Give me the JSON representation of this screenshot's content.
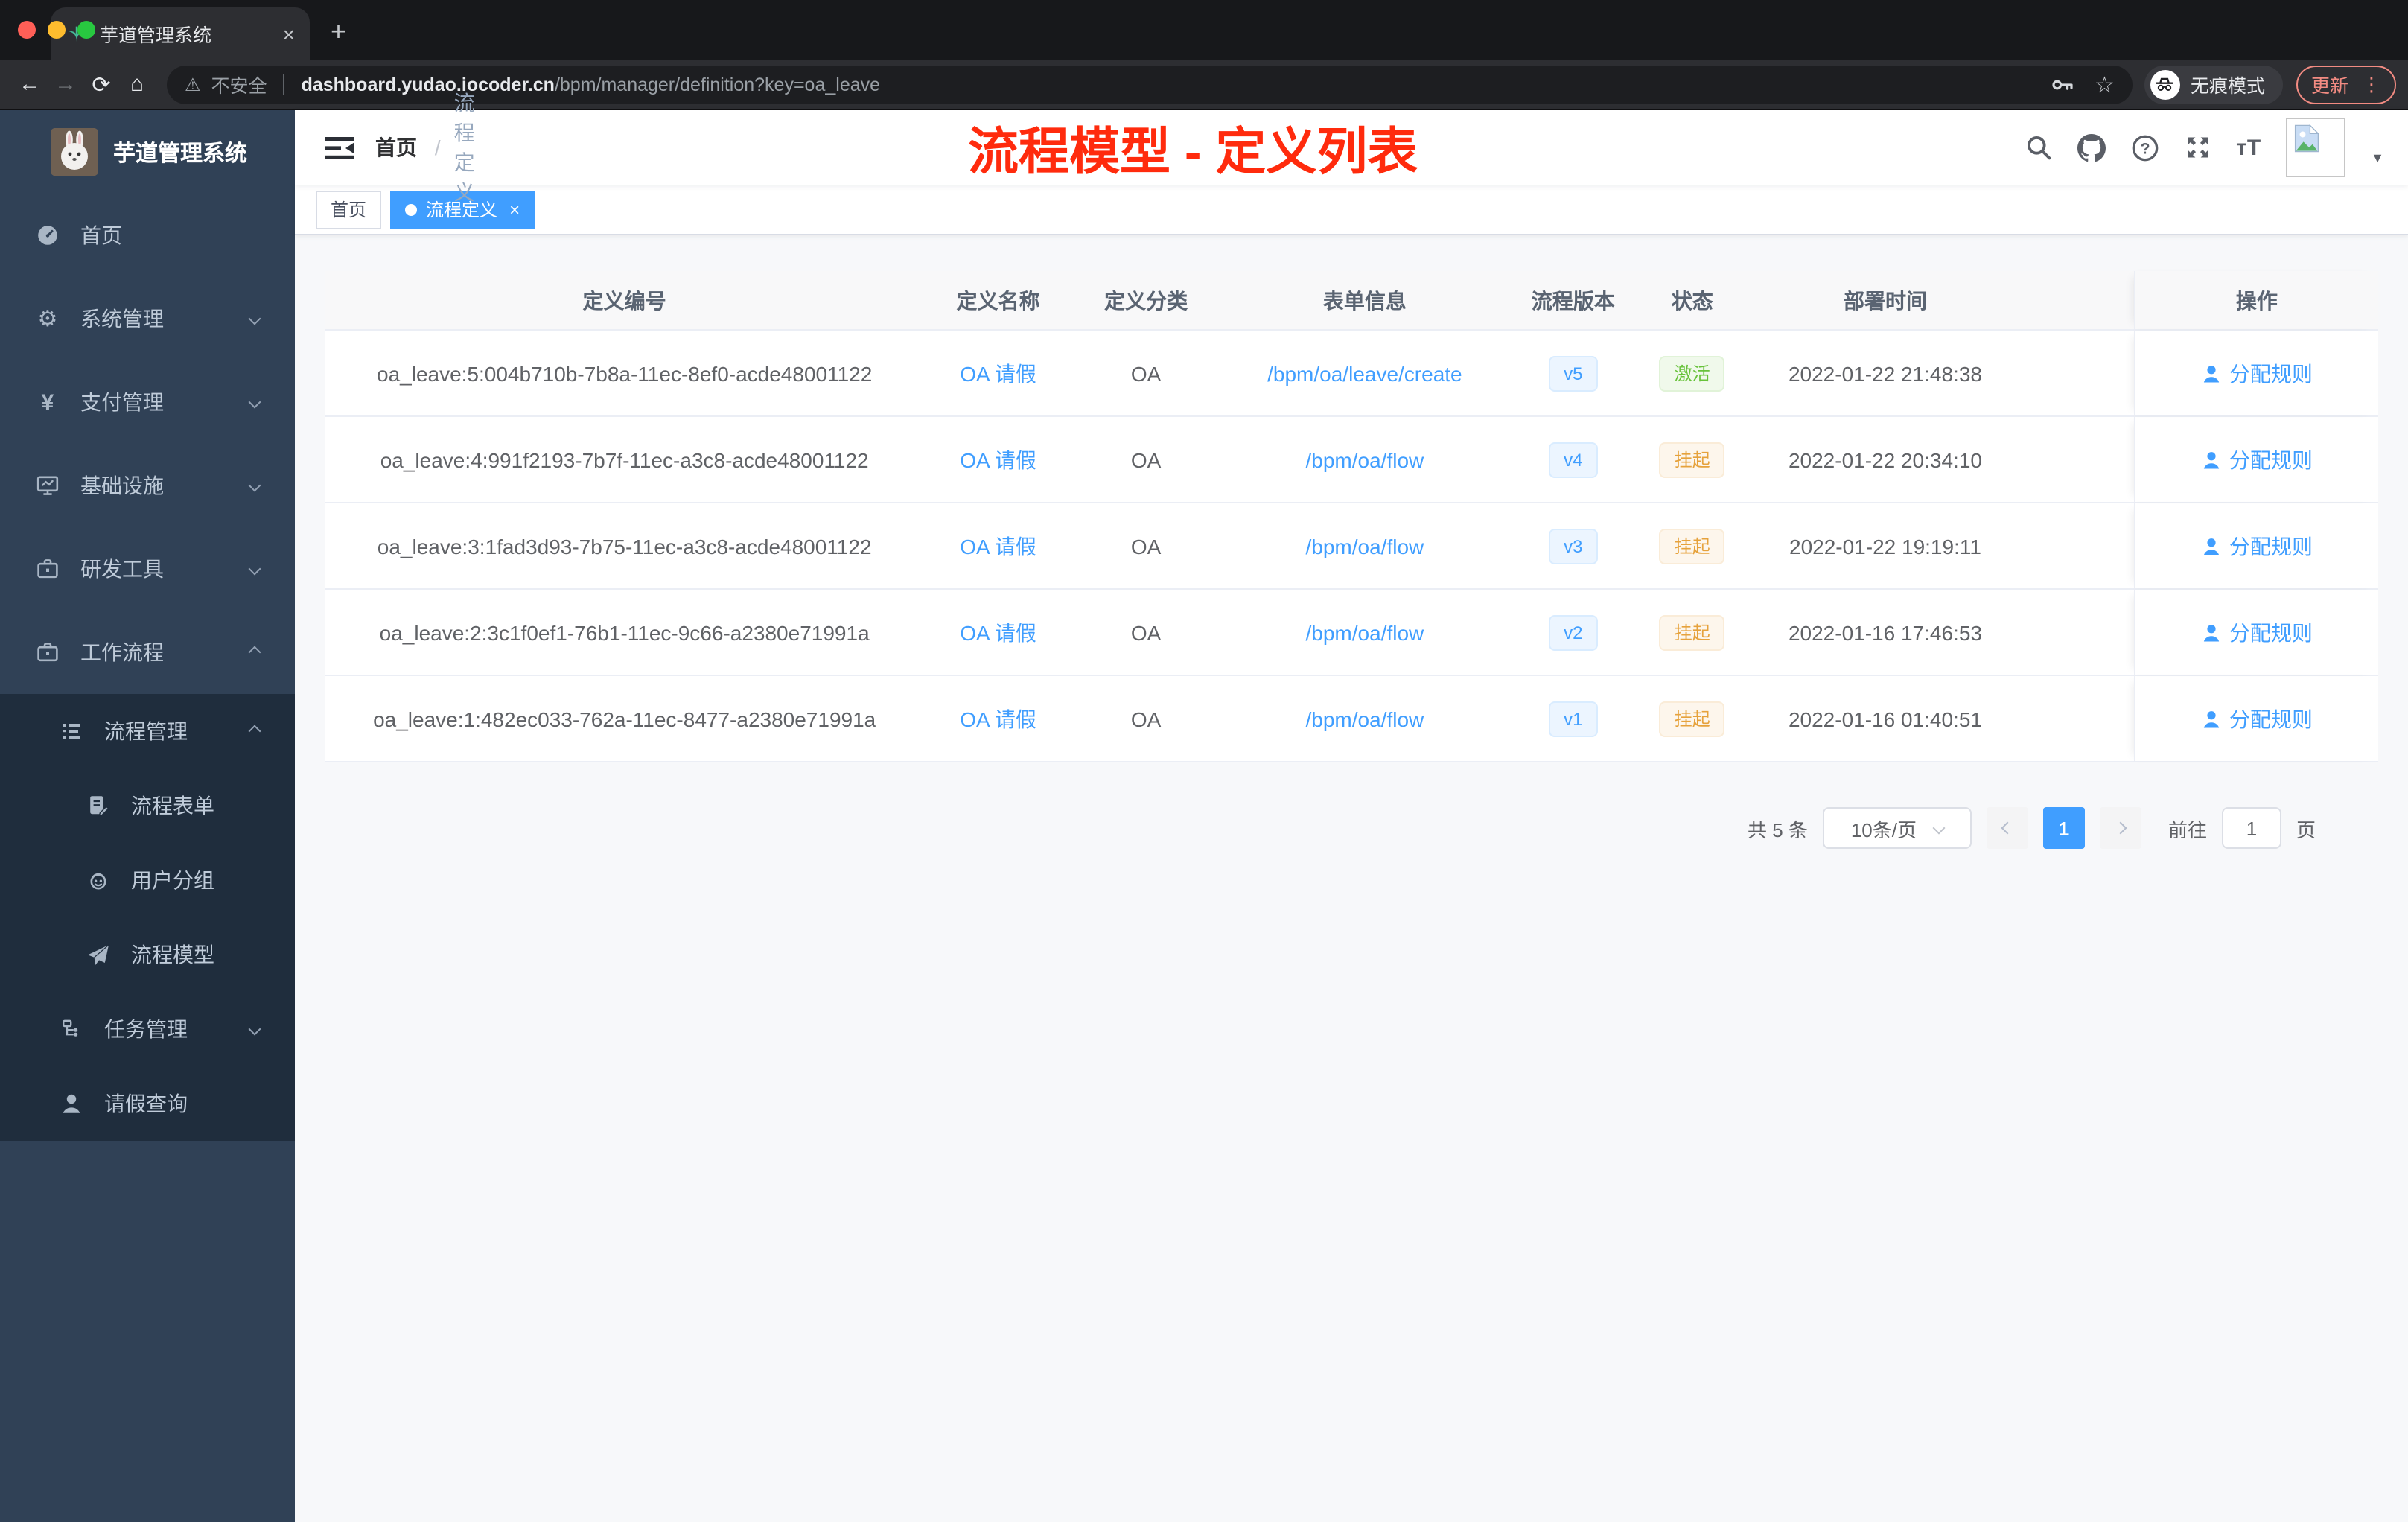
{
  "browser": {
    "tab_title": "芋道管理系统",
    "new_tab_glyph": "+",
    "security_label": "不安全",
    "url_host": "dashboard.yudao.iocoder.cn",
    "url_path": "/bpm/manager/definition?key=oa_leave",
    "incognito_label": "无痕模式",
    "update_label": "更新",
    "glyphs": {
      "back": "←",
      "forward": "→",
      "reload": "⟳",
      "home": "⌂",
      "warning": "⚠",
      "star": "☆",
      "close": "×",
      "dots": "⋮"
    }
  },
  "sidebar": {
    "logo_title": "芋道管理系统",
    "items": [
      {
        "label": "首页"
      },
      {
        "label": "系统管理"
      },
      {
        "label": "支付管理"
      },
      {
        "label": "基础设施"
      },
      {
        "label": "研发工具"
      },
      {
        "label": "工作流程"
      },
      {
        "label": "流程管理"
      },
      {
        "label": "流程表单"
      },
      {
        "label": "用户分组"
      },
      {
        "label": "流程模型"
      },
      {
        "label": "任务管理"
      },
      {
        "label": "请假查询"
      }
    ],
    "glyphs": {
      "gear": "⚙",
      "yen": "¥"
    }
  },
  "header": {
    "breadcrumb": {
      "home": "首页",
      "sep": "/",
      "current": "流程定义"
    },
    "annotation": "流程模型 - 定义列表",
    "caret": "▼",
    "font_size_icon_label": "тT"
  },
  "tags": [
    {
      "label": "首页"
    },
    {
      "label": "流程定义",
      "close": "×"
    }
  ],
  "table": {
    "columns": [
      "定义编号",
      "定义名称",
      "定义分类",
      "表单信息",
      "流程版本",
      "状态",
      "部署时间",
      "操作"
    ],
    "rows": [
      {
        "id": "oa_leave:5:004b710b-7b8a-11ec-8ef0-acde48001122",
        "name": "OA 请假",
        "category": "OA",
        "form": "/bpm/oa/leave/create",
        "version": "v5",
        "status": "激活",
        "deploy_time": "2022-01-22 21:48:38",
        "action": "分配规则"
      },
      {
        "id": "oa_leave:4:991f2193-7b7f-11ec-a3c8-acde48001122",
        "name": "OA 请假",
        "category": "OA",
        "form": "/bpm/oa/flow",
        "version": "v4",
        "status": "挂起",
        "deploy_time": "2022-01-22 20:34:10",
        "action": "分配规则"
      },
      {
        "id": "oa_leave:3:1fad3d93-7b75-11ec-a3c8-acde48001122",
        "name": "OA 请假",
        "category": "OA",
        "form": "/bpm/oa/flow",
        "version": "v3",
        "status": "挂起",
        "deploy_time": "2022-01-22 19:19:11",
        "action": "分配规则"
      },
      {
        "id": "oa_leave:2:3c1f0ef1-76b1-11ec-9c66-a2380e71991a",
        "name": "OA 请假",
        "category": "OA",
        "form": "/bpm/oa/flow",
        "version": "v2",
        "status": "挂起",
        "deploy_time": "2022-01-16 17:46:53",
        "action": "分配规则"
      },
      {
        "id": "oa_leave:1:482ec033-762a-11ec-8477-a2380e71991a",
        "name": "OA 请假",
        "category": "OA",
        "form": "/bpm/oa/flow",
        "version": "v1",
        "status": "挂起",
        "deploy_time": "2022-01-16 01:40:51",
        "action": "分配规则"
      }
    ]
  },
  "pagination": {
    "total_label": "共 5 条",
    "page_size": "10条/页",
    "current_page": "1",
    "goto_label": "前往",
    "goto_value": "1",
    "page_unit": "页"
  },
  "colors": {
    "accent": "#409eff",
    "sidebar_bg": "#304156",
    "submenu_bg": "#1f2d3d",
    "success": "#67c23a",
    "warning": "#e6a23c",
    "annotation_red": "#ff2b0d"
  }
}
